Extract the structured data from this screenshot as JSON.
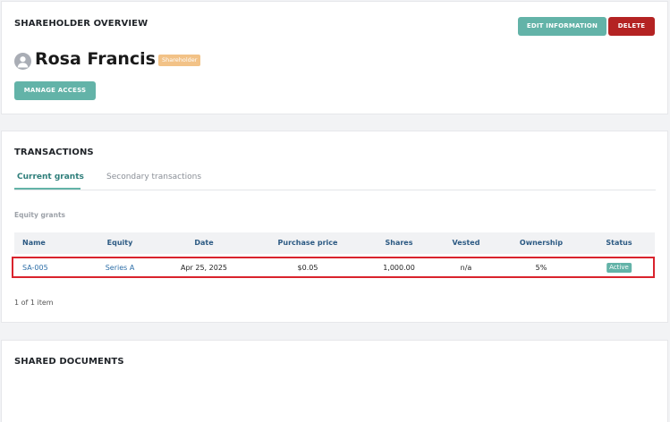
{
  "overview": {
    "title": "SHAREHOLDER OVERVIEW",
    "edit_label": "EDIT INFORMATION",
    "delete_label": "DELETE",
    "name": "Rosa Francis",
    "role_badge": "Shareholder",
    "manage_access_label": "MANAGE ACCESS",
    "colors": {
      "accent": "#63b3a8",
      "danger": "#b42323",
      "badge": "#f2c287"
    }
  },
  "transactions": {
    "title": "TRANSACTIONS",
    "tabs": [
      {
        "label": "Current grants",
        "active": true
      },
      {
        "label": "Secondary transactions",
        "active": false
      }
    ],
    "section_label": "Equity grants",
    "columns": [
      "Name",
      "Equity",
      "Date",
      "Purchase price",
      "Shares",
      "Vested",
      "Ownership",
      "Status"
    ],
    "rows": [
      {
        "name": "SA-005",
        "equity": "Series A",
        "date": "Apr 25, 2025",
        "purchase_price": "$0.05",
        "shares": "1,000.00",
        "vested": "n/a",
        "ownership": "5%",
        "status": "Active"
      }
    ],
    "pagination": "1 of 1 item"
  },
  "documents": {
    "title": "SHARED DOCUMENTS"
  }
}
